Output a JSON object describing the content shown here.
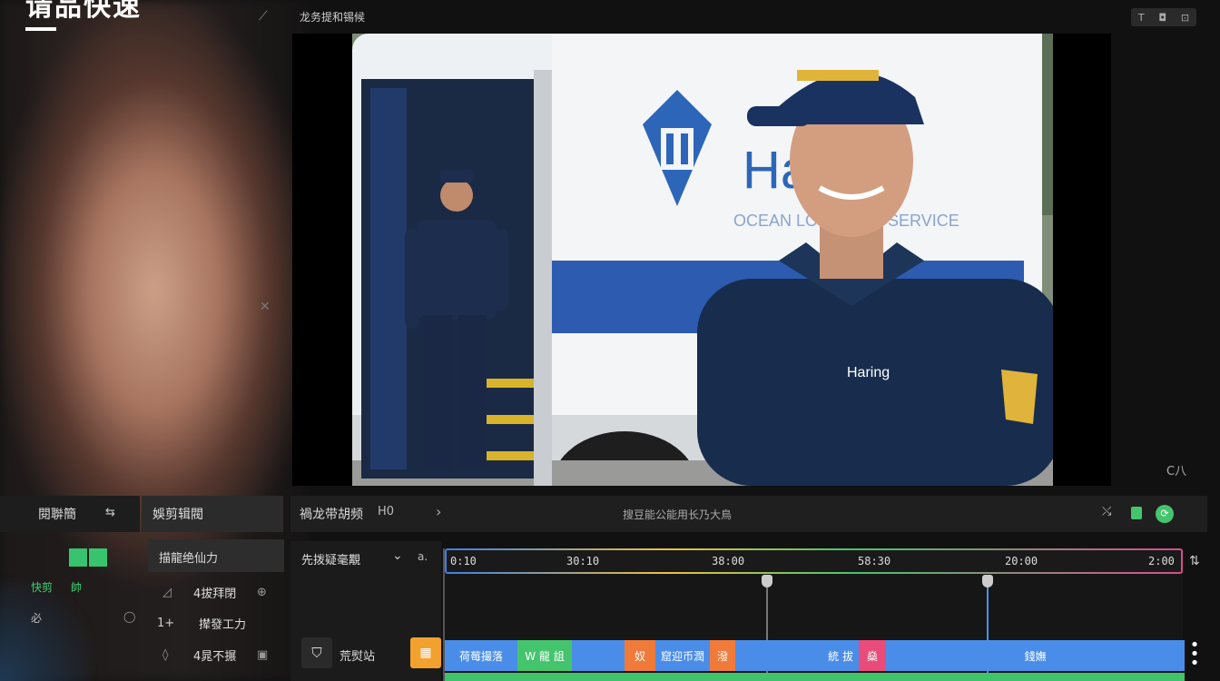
{
  "overlay": {
    "title": "请品快速",
    "top_icon": "pin-icon",
    "side_icon": "close-icon"
  },
  "preview": {
    "title": "龙务提和锡候",
    "corner_label": "C八",
    "toolbar_icons": [
      "T",
      "◘",
      "⊡"
    ]
  },
  "left_panel": {
    "tab_a": "閱聨簡",
    "tab_a_icon": "⇆",
    "tab_b": "娛剪辑閥",
    "rows": [
      "快剪",
      "帥",
      "必"
    ]
  },
  "properties": {
    "header": "描龍绝仙力",
    "items": [
      {
        "icon": "◿",
        "label": "4拔拜閉",
        "action": "⊕"
      },
      {
        "icon": "1+",
        "label": "撵發工力",
        "action": ""
      },
      {
        "icon": "◊",
        "label": "4晁不搌",
        "action": "▣"
      }
    ]
  },
  "timeline": {
    "header_title": "禍龙带胡频",
    "header_badge": "H0",
    "header_center": "搜豆能公能用长乃大鳥",
    "track_group": "先拨疑毫覯",
    "ruler_ticks": [
      "0:10",
      "30:10",
      "38:00",
      "58:30",
      "20:00",
      "2:00"
    ],
    "track_name": "荒熨站",
    "clips": [
      {
        "label": "荷莓撮落",
        "color": "#4a8de8"
      },
      {
        "label": "W  龍 詛",
        "color": "#45c46e"
      },
      {
        "label": "奴",
        "color": "#f07a3a"
      },
      {
        "label": "窟迎币潤",
        "color": "#4a8de8"
      },
      {
        "label": "潑",
        "color": "#f07a3a"
      },
      {
        "label": "統 拔",
        "color": "#4a8de8"
      },
      {
        "label": "燊",
        "color": "#e94b7b"
      },
      {
        "label": "錢嫵",
        "color": "#4a8de8"
      }
    ]
  },
  "colors": {
    "accent_blue": "#4a8de8",
    "accent_green": "#45c46e",
    "accent_orange": "#f07a3a",
    "accent_pink": "#e94b7b"
  }
}
